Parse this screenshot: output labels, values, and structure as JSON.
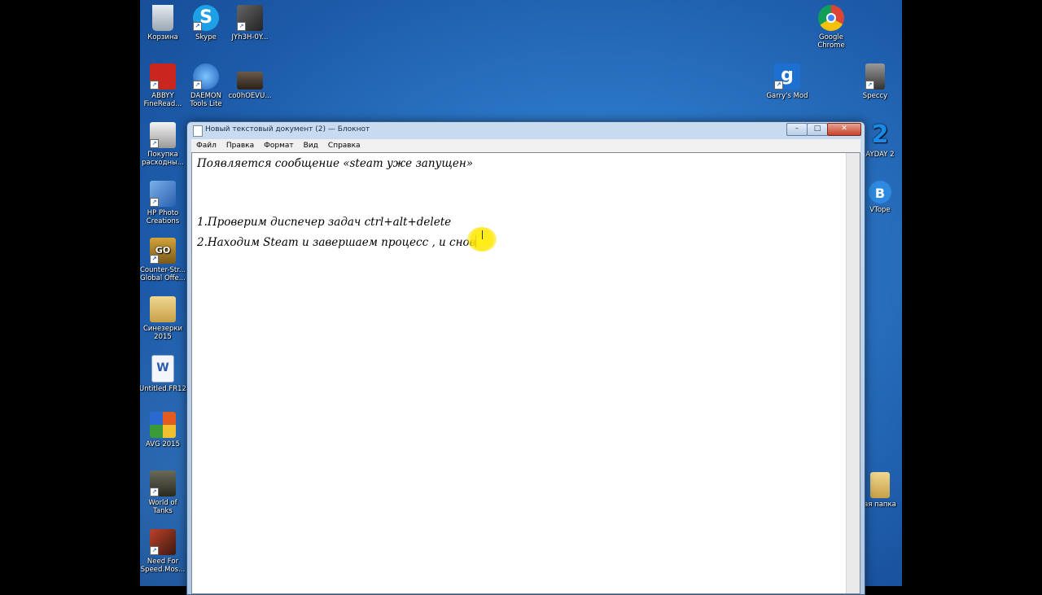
{
  "desktop": {
    "icons_left": [
      {
        "id": "recycle",
        "label": "Корзина",
        "color": "#bfc7cf"
      },
      {
        "id": "skype",
        "label": "Skype",
        "color": "#1ea0e6"
      },
      {
        "id": "video1",
        "label": "JYh3H-0Y...",
        "color": "#3a3a3a"
      },
      {
        "id": "abbyy",
        "label": "ABBYY FineRead...",
        "color": "#c8261e"
      },
      {
        "id": "daemon",
        "label": "DAEMON Tools Lite",
        "color": "#2a7fd6"
      },
      {
        "id": "video2",
        "label": "co0hOEVU...",
        "color": "#4a3a2a"
      },
      {
        "id": "printer",
        "label": "Покупка расходны...",
        "color": "#d8d8d8"
      },
      {
        "id": "hpphoto",
        "label": "HP Photo Creations",
        "color": "#3a78c8"
      },
      {
        "id": "csgo",
        "label": "Counter-Str... Global Offe...",
        "color": "#b98a2c"
      },
      {
        "id": "folder1",
        "label": "Синезерки 2015",
        "color": "#d7b45a"
      },
      {
        "id": "word",
        "label": "Untitled.FR12",
        "color": "#e8eef8"
      },
      {
        "id": "avg",
        "label": "AVG 2015",
        "color": "#e35b1e"
      },
      {
        "id": "wot",
        "label": "World of Tanks",
        "color": "#4a4a3a"
      },
      {
        "id": "nfs",
        "label": "Need For Speed.Mos...",
        "color": "#7a2a1a"
      }
    ],
    "icons_right": [
      {
        "id": "chrome",
        "label": "Google Chrome",
        "color": "#e0b020"
      },
      {
        "id": "gmod",
        "label": "Garry's Mod",
        "color": "#1d6fd0"
      },
      {
        "id": "speccy",
        "label": "Speccy",
        "color": "#666666"
      },
      {
        "id": "payday",
        "label": "AYDAY 2",
        "color": "#1a6fd0"
      },
      {
        "id": "vk",
        "label": "VTope",
        "color": "#2d8ae0"
      },
      {
        "id": "folder2",
        "label": "ая папка",
        "color": "#d9b65c"
      }
    ]
  },
  "window": {
    "title": "Новый текстовый документ (2) — Блокнот",
    "controls": {
      "minimize": "–",
      "maximize": "□",
      "close": "✕"
    },
    "menu": [
      "Файл",
      "Правка",
      "Формат",
      "Вид",
      "Справка"
    ]
  },
  "editor": {
    "lines": [
      "Появляется сообщение «steam уже запущен»",
      "",
      "",
      "1.Проверим диспечер задач ctrl+alt+delete",
      "2.Находим Steam и завершаем процесс , и снов"
    ]
  }
}
